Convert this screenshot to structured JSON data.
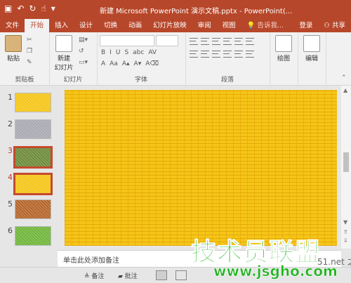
{
  "app": {
    "title": "新建 Microsoft PowerPoint 演示文稿.pptx - PowerPoint(..."
  },
  "qat": {
    "save_icon": "save-icon",
    "undo_icon": "undo-icon",
    "redo_icon": "redo-icon",
    "touch_icon": "touch-mode-icon",
    "customize_icon": "customize-icon"
  },
  "tabs": [
    {
      "label": "文件"
    },
    {
      "label": "开始"
    },
    {
      "label": "插入"
    },
    {
      "label": "设计"
    },
    {
      "label": "切换"
    },
    {
      "label": "动画"
    },
    {
      "label": "幻灯片放映"
    },
    {
      "label": "审阅"
    },
    {
      "label": "视图"
    }
  ],
  "tell_me": "告诉我...",
  "signin": "登录",
  "share": "共享",
  "ribbon": {
    "clipboard": {
      "paste": "粘贴",
      "label": "剪贴板"
    },
    "slides": {
      "new_slide": "新建",
      "new_slide2": "幻灯片",
      "label": "幻灯片"
    },
    "font": {
      "label": "字体"
    },
    "paragraph": {
      "label": "段落"
    },
    "drawing": {
      "label": "绘图"
    },
    "editing": {
      "label": "编辑"
    }
  },
  "thumbnails": [
    {
      "num": "1",
      "color": "#f5c518"
    },
    {
      "num": "2",
      "color": "#a9a9b3"
    },
    {
      "num": "3",
      "color": "#6d8b3a"
    },
    {
      "num": "4",
      "color": "#f5c518"
    },
    {
      "num": "5",
      "color": "#b5652a"
    },
    {
      "num": "6",
      "color": "#6fb53a"
    }
  ],
  "selected_thumbnail": "4",
  "notes_placeholder": "单击此处添加备注",
  "status": {
    "notes": "备注",
    "comments": "批注"
  },
  "watermark": {
    "brand": "技术员联盟",
    "url": "www.jsgho.com",
    "small": "51.net 之家"
  },
  "colors": {
    "accent": "#b7472a",
    "slide_fill": "#f5c518"
  }
}
